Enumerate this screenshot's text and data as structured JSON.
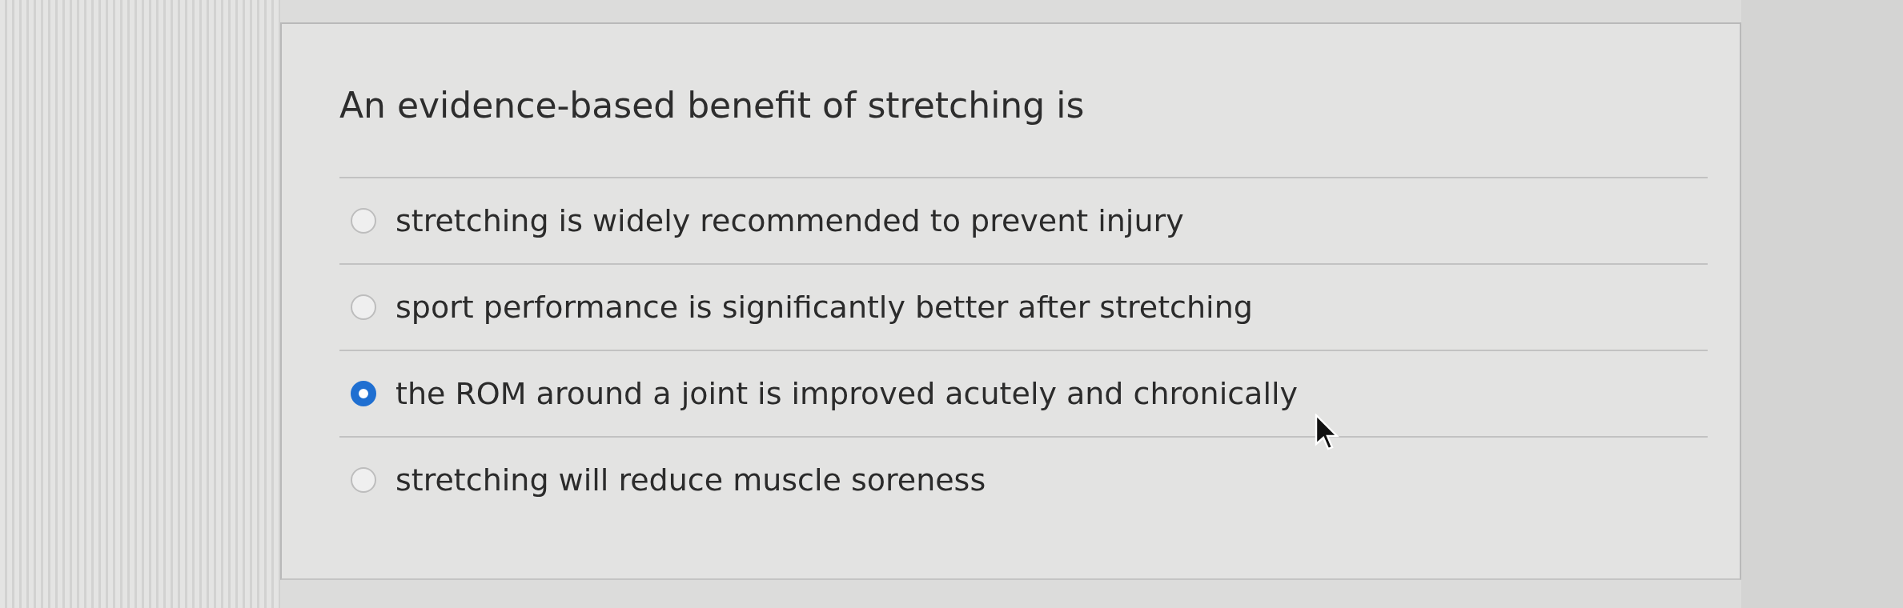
{
  "question": {
    "text": "An evidence-based benefit of stretching is"
  },
  "options": [
    {
      "label": "stretching is widely recommended to prevent injury",
      "selected": false
    },
    {
      "label": "sport performance is significantly better after stretching",
      "selected": false
    },
    {
      "label": "the ROM around a joint is improved acutely and chronically",
      "selected": true
    },
    {
      "label": "stretching will reduce muscle soreness",
      "selected": false
    }
  ]
}
